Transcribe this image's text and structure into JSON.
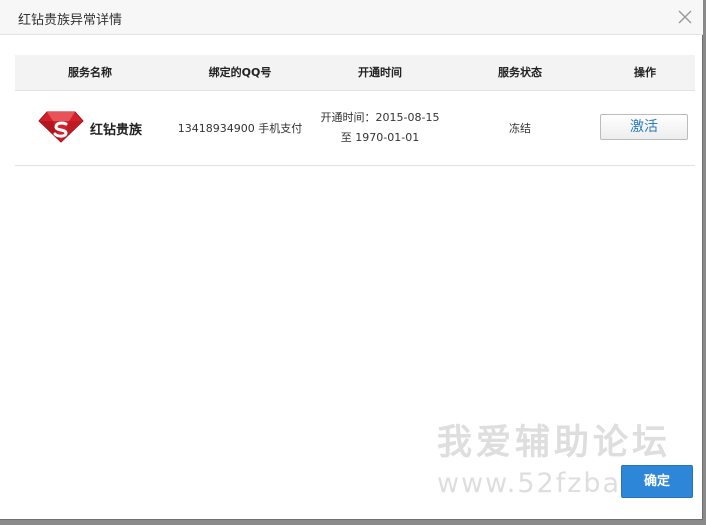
{
  "dialog": {
    "title": "红钻贵族异常详情"
  },
  "table": {
    "headers": [
      "服务名称",
      "绑定的QQ号",
      "开通时间",
      "服务状态",
      "操作"
    ],
    "rows": [
      {
        "service_icon": "red-diamond-icon",
        "service_name": "红钻贵族",
        "qq": "13418934900 手机支付",
        "time_start": "开通时间：2015-08-15",
        "time_end": "至 1970-01-01",
        "status": "冻结",
        "action_label": "激活"
      }
    ]
  },
  "watermark": {
    "text": "我爱辅助论坛",
    "url": "www.52fzba"
  },
  "footer": {
    "ok_label": "确定"
  },
  "colors": {
    "accent": "#2e86d9",
    "link": "#2a7ac0",
    "diamond": "#d4202a"
  }
}
